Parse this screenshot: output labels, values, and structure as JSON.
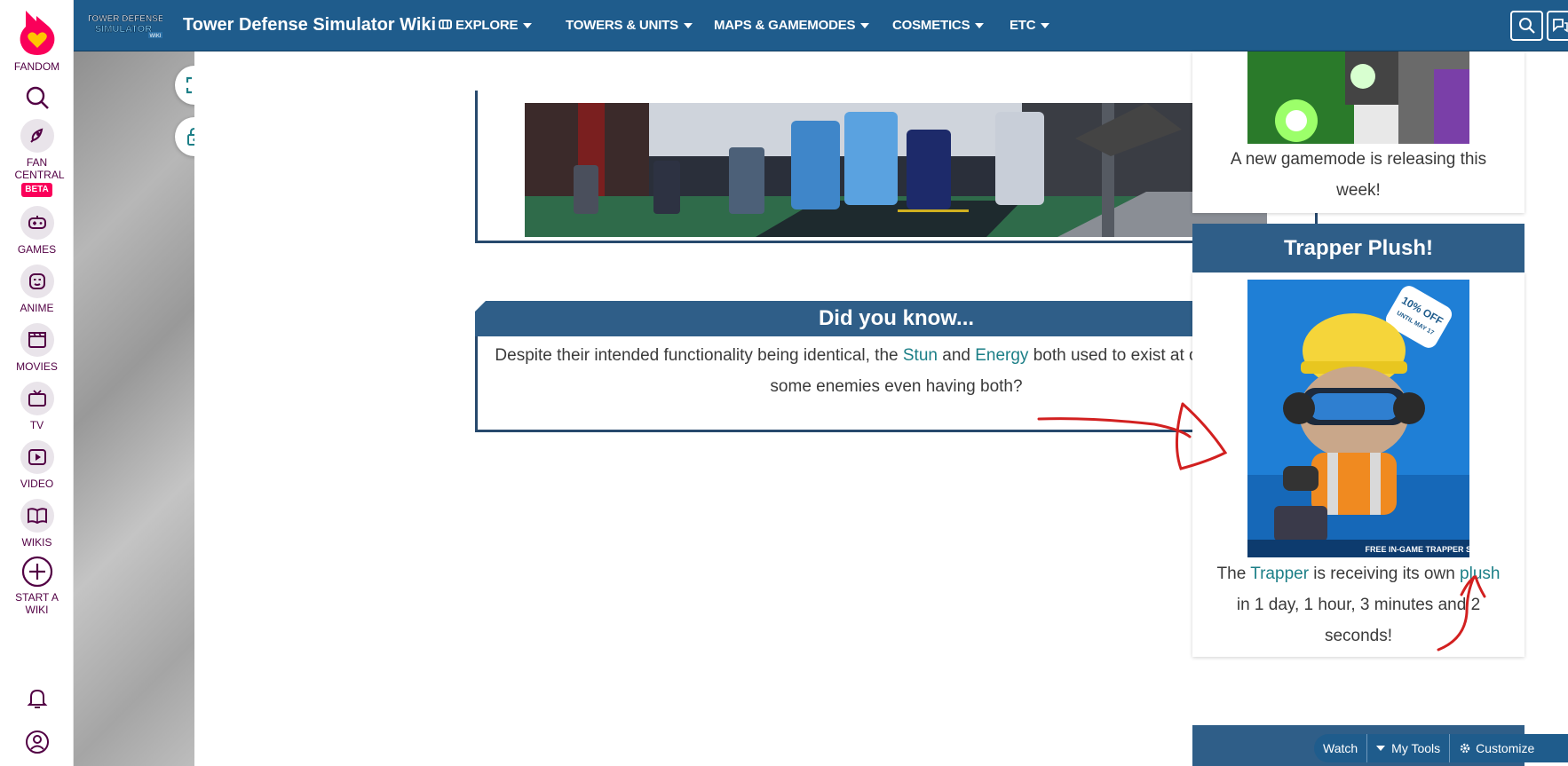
{
  "fandom_rail": {
    "items": [
      {
        "label": "FANDOM",
        "icon": "fandom-heart-logo"
      },
      {
        "label": "",
        "icon": "search-icon"
      },
      {
        "label": "FAN CENTRAL",
        "badge": "BETA",
        "icon": "rocket-icon"
      },
      {
        "label": "GAMES",
        "icon": "gamepad-icon"
      },
      {
        "label": "ANIME",
        "icon": "anime-face-icon"
      },
      {
        "label": "MOVIES",
        "icon": "clapperboard-icon"
      },
      {
        "label": "TV",
        "icon": "tv-icon"
      },
      {
        "label": "VIDEO",
        "icon": "play-icon"
      },
      {
        "label": "WIKIS",
        "icon": "book-icon"
      },
      {
        "label": "START A WIKI",
        "icon": "plus-circle-icon"
      }
    ],
    "notifications_icon": "bell-icon",
    "user_icon": "user-circle-icon"
  },
  "topnav": {
    "logo_text_1": "TOWER DEFENSE",
    "logo_text_2": "SIMULATOR",
    "logo_text_3": "WIKI",
    "wiki_title": "Tower Defense Simulator Wiki",
    "menu": [
      {
        "label": "EXPLORE",
        "icon": "explore-icon"
      },
      {
        "label": "TOWERS & UNITS"
      },
      {
        "label": "MAPS & GAMEMODES"
      },
      {
        "label": "COSMETICS"
      },
      {
        "label": "ETC"
      }
    ],
    "colors": {
      "bar": "#1f5c8c"
    }
  },
  "page_tools": {
    "expand_icon": "expand-icon",
    "lock_icon": "lock-icon"
  },
  "did_you_know": {
    "heading": "Did you know...",
    "text_1": "Despite their intended functionality being identical, the ",
    "link_1": "Stun",
    "text_2": " and ",
    "link_2": "Energy",
    "text_3": " both used to exist at one point, with some enemies even having both?"
  },
  "right_rail": {
    "gamemode_caption_1": "A new gamemode is releasing this",
    "gamemode_caption_2": "week!",
    "trapper_heading": "Trapper Plush!",
    "promo_badge": "10% OFF UNTIL MAY 17",
    "promo_footer": "FREE IN-GAME TRAPPER SKIN",
    "text_1": "The ",
    "link_trapper": "Trapper",
    "text_2": " is receiving its own ",
    "link_plush": "plush",
    "countdown_line": "in 1 day, 1 hour, 3 minutes and 2",
    "countdown_end": "seconds!"
  },
  "bottom_tools": {
    "watch": "Watch",
    "my_tools": "My Tools",
    "customize": "Customize"
  },
  "colors": {
    "accent_link": "#1c7f87",
    "header_blue": "#2f5e88",
    "annotation_red": "#d22020"
  }
}
